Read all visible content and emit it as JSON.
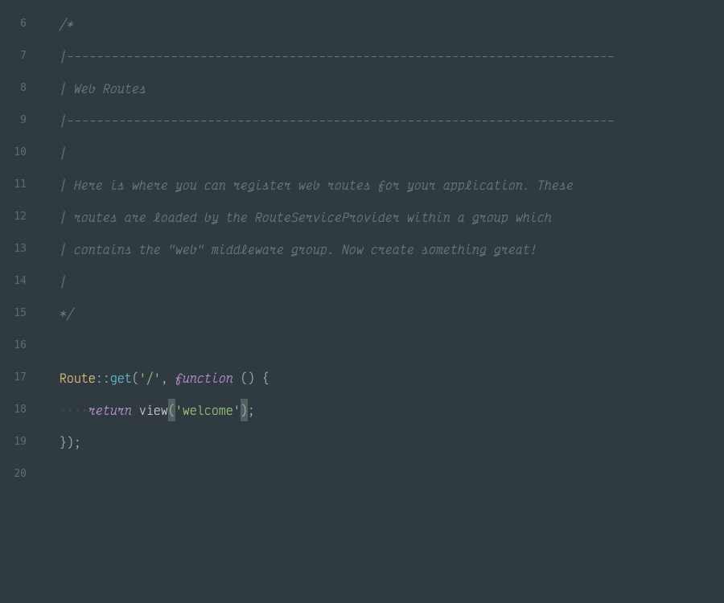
{
  "first_line_number": 6,
  "lines": [
    {
      "n": 6,
      "tokens": [
        {
          "t": "/*",
          "c": "comment"
        }
      ]
    },
    {
      "n": 7,
      "tokens": [
        {
          "t": "|--------------------------------------------------------------------------",
          "c": "comment-dash"
        }
      ]
    },
    {
      "n": 8,
      "tokens": [
        {
          "t": "| Web Routes",
          "c": "comment"
        }
      ]
    },
    {
      "n": 9,
      "tokens": [
        {
          "t": "|--------------------------------------------------------------------------",
          "c": "comment-dash"
        }
      ]
    },
    {
      "n": 10,
      "tokens": [
        {
          "t": "|",
          "c": "comment"
        }
      ]
    },
    {
      "n": 11,
      "tokens": [
        {
          "t": "| Here is where you can register web routes for your application. These",
          "c": "comment"
        }
      ]
    },
    {
      "n": 12,
      "tokens": [
        {
          "t": "| routes are loaded by the RouteServiceProvider within a group which",
          "c": "comment"
        }
      ]
    },
    {
      "n": 13,
      "tokens": [
        {
          "t": "| contains the \"web\" middleware group. Now create something great!",
          "c": "comment"
        }
      ]
    },
    {
      "n": 14,
      "tokens": [
        {
          "t": "|",
          "c": "comment"
        }
      ]
    },
    {
      "n": 15,
      "tokens": [
        {
          "t": "*/",
          "c": "comment"
        }
      ]
    },
    {
      "n": 16,
      "tokens": []
    },
    {
      "n": 17,
      "tokens": [
        {
          "t": "Route",
          "c": "class-name"
        },
        {
          "t": "::",
          "c": "op"
        },
        {
          "t": "get",
          "c": "method"
        },
        {
          "t": "(",
          "c": "paren"
        },
        {
          "t": "'/'",
          "c": "string"
        },
        {
          "t": ", ",
          "c": "comma"
        },
        {
          "t": "function",
          "c": "keyword"
        },
        {
          "t": " ",
          "c": ""
        },
        {
          "t": "()",
          "c": "paren"
        },
        {
          "t": " ",
          "c": ""
        },
        {
          "t": "{",
          "c": "brace"
        }
      ]
    },
    {
      "n": 18,
      "tokens": [
        {
          "t": "····",
          "c": "ws-dots"
        },
        {
          "t": "return",
          "c": "keyword"
        },
        {
          "t": " ",
          "c": ""
        },
        {
          "t": "view",
          "c": "func"
        },
        {
          "t": "(",
          "c": "paren hl"
        },
        {
          "t": "'welcome'",
          "c": "string"
        },
        {
          "t": ")",
          "c": "paren hl"
        },
        {
          "t": ";",
          "c": "semi"
        }
      ]
    },
    {
      "n": 19,
      "tokens": [
        {
          "t": "}",
          "c": "brace"
        },
        {
          "t": ")",
          "c": "paren"
        },
        {
          "t": ";",
          "c": "semi"
        }
      ]
    },
    {
      "n": 20,
      "tokens": []
    }
  ]
}
